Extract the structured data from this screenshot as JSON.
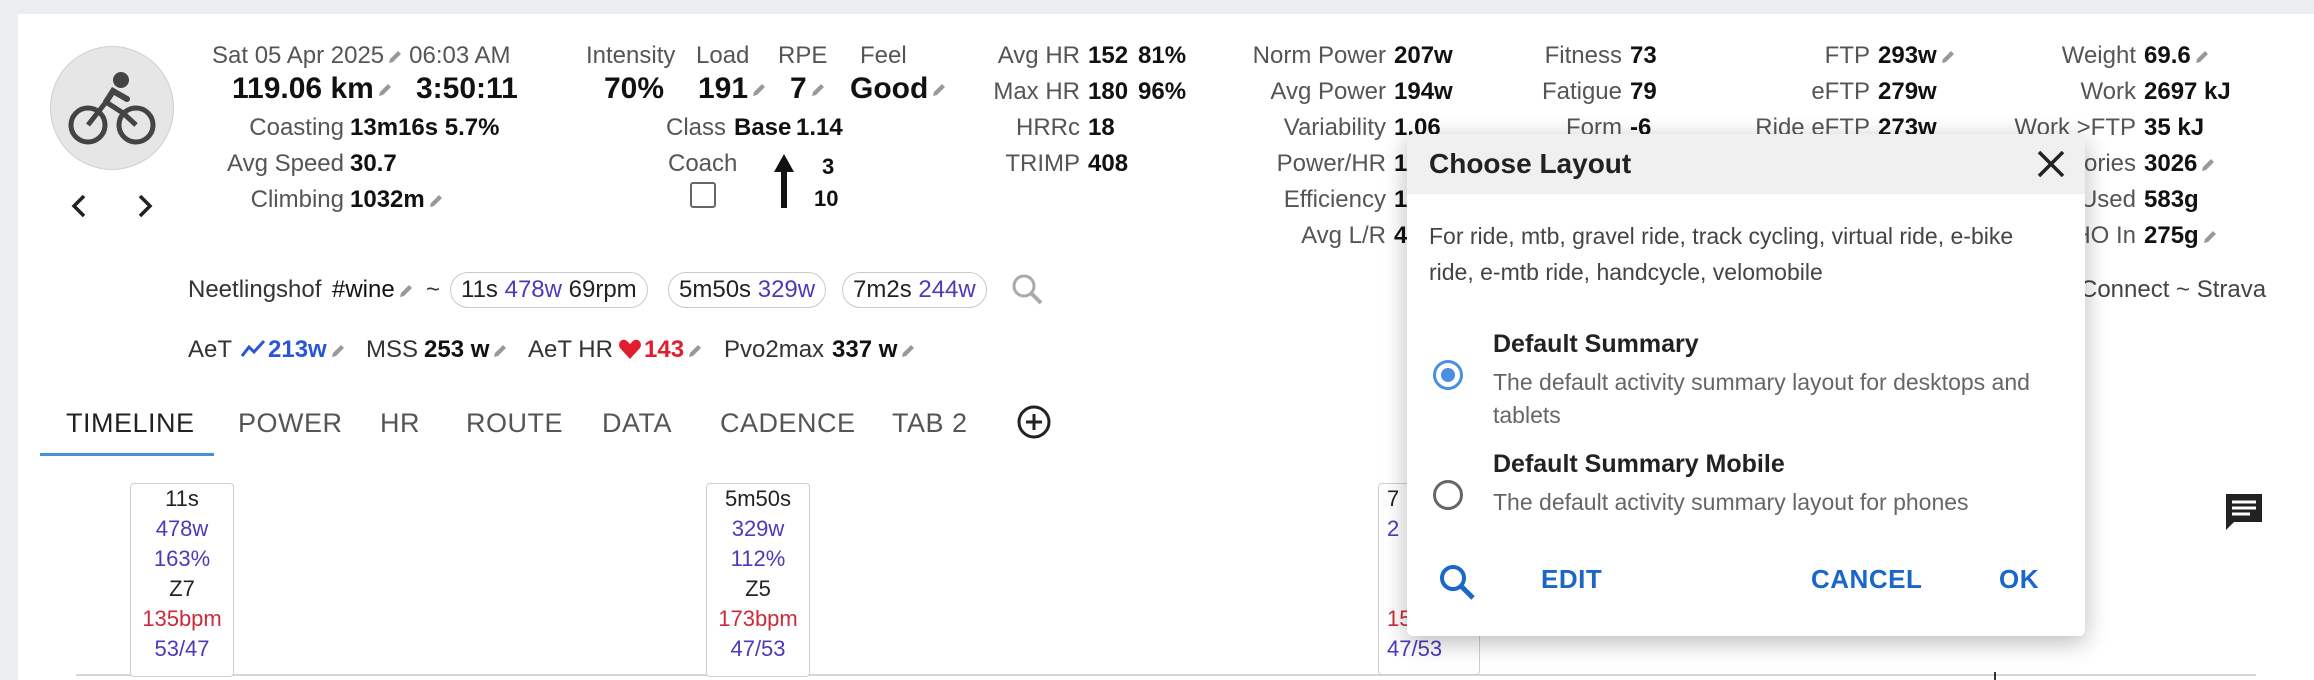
{
  "colors": {
    "accent": "#4a90d9",
    "power": "#4b3bb8",
    "hr": "#cc2a3a",
    "link": "#1a66c9"
  },
  "activity": {
    "icon": "cycling-icon",
    "date": "Sat 05 Apr 2025",
    "time": "06:03 AM",
    "distance": "119.06 km",
    "duration": "3:50:11",
    "coasting_label": "Coasting",
    "coasting_value": "13m16s 5.7%",
    "avg_speed_label": "Avg Speed",
    "avg_speed_value": "30.7",
    "climbing_label": "Climbing",
    "climbing_value": "1032m"
  },
  "effort": {
    "intensity_label": "Intensity",
    "intensity_value": "70%",
    "load_label": "Load",
    "load_value": "191",
    "rpe_label": "RPE",
    "rpe_value": "7",
    "feel_label": "Feel",
    "feel_value": "Good",
    "class_label": "Class",
    "class_value": "Base",
    "class_num": "1.14",
    "coach_label": "Coach",
    "arrow_top": "3",
    "arrow_bottom": "10"
  },
  "hr": {
    "avg_label": "Avg HR",
    "avg_value": "152",
    "avg_pct": "81%",
    "max_label": "Max HR",
    "max_value": "180",
    "max_pct": "96%",
    "hrrc_label": "HRRc",
    "hrrc_value": "18",
    "trimp_label": "TRIMP",
    "trimp_value": "408"
  },
  "power": {
    "norm_label": "Norm Power",
    "norm_value": "207w",
    "avg_label": "Avg Power",
    "avg_value": "194w",
    "var_label": "Variability",
    "var_value": "1.06",
    "phr_label": "Power/HR",
    "phr_value": "1",
    "eff_label": "Efficiency",
    "eff_value": "1",
    "lr_label": "Avg L/R",
    "lr_value": "4"
  },
  "fitness": {
    "fitness_label": "Fitness",
    "fitness_value": "73",
    "fatigue_label": "Fatigue",
    "fatigue_value": "79",
    "form_label": "Form",
    "form_value": "-6"
  },
  "ftp": {
    "ftp_label": "FTP",
    "ftp_value": "293w",
    "eftp_label": "eFTP",
    "eftp_value": "279w",
    "ride_label": "Ride eFTP",
    "ride_value": "273w"
  },
  "body": {
    "weight_label": "Weight",
    "weight_value": "69.6",
    "work_label": "Work",
    "work_value": "2697 kJ",
    "workftp_label": "Work >FTP",
    "workftp_value": "35 kJ",
    "cal_label": "lories",
    "cal_value": "3026",
    "used_label": "Used",
    "used_value": "583g",
    "cho_label": "HO In",
    "cho_value": "275g",
    "links": "Connect ~ Strava"
  },
  "tags": {
    "name": "Neetlingshof",
    "hashtag": "#wine",
    "tilde": "~",
    "chips": [
      {
        "t": "11s",
        "p": "478w",
        "x": "69rpm"
      },
      {
        "t": "5m50s",
        "p": "329w"
      },
      {
        "t": "7m2s",
        "p": "244w"
      }
    ]
  },
  "thresholds": {
    "aet_label": "AeT",
    "aet_value": "213w",
    "mss_label": "MSS",
    "mss_value": "253 w",
    "aethr_label": "AeT HR",
    "aethr_value": "143",
    "pvo_label": "Pvo2max",
    "pvo_value": "337 w"
  },
  "tabs": [
    "TIMELINE",
    "POWER",
    "HR",
    "ROUTE",
    "DATA",
    "CADENCE",
    "TAB 2"
  ],
  "intervals": [
    {
      "time": "11s",
      "power": "478w",
      "pct": "163%",
      "zone": "Z7",
      "hr": "135bpm",
      "lr": "53/47"
    },
    {
      "time": "5m50s",
      "power": "329w",
      "pct": "112%",
      "zone": "Z5",
      "hr": "173bpm",
      "lr": "47/53"
    },
    {
      "time": "7",
      "power": "2",
      "pct": "",
      "zone": "",
      "hr": "15",
      "lr": "47/53"
    }
  ],
  "modal": {
    "title": "Choose Layout",
    "description": "For ride, mtb, gravel ride, track cycling, virtual ride, e-bike ride, e-mtb ride, handcycle, velomobile",
    "options": [
      {
        "title": "Default Summary",
        "desc": "The default activity summary layout for desktops and tablets",
        "selected": true
      },
      {
        "title": "Default Summary Mobile",
        "desc": "The default activity summary layout for phones",
        "selected": false
      }
    ],
    "edit": "EDIT",
    "cancel": "CANCEL",
    "ok": "OK"
  }
}
